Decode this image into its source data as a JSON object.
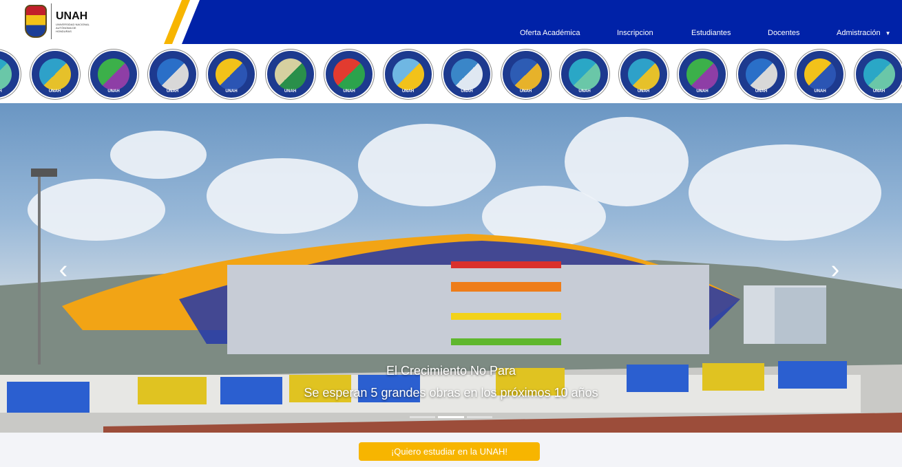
{
  "header": {
    "logo_name": "UNAH",
    "logo_sub": "UNIVERSIDAD NACIONAL AUTÓNOMA DE HONDURAS",
    "nav": [
      {
        "label": "Oferta Académica"
      },
      {
        "label": "Inscripcion"
      },
      {
        "label": "Estudiantes"
      },
      {
        "label": "Docentes"
      },
      {
        "label": "Admistración"
      }
    ],
    "colors": {
      "primary": "#0022a8",
      "accent": "#f7b500"
    }
  },
  "faculties": [
    {
      "label": "UNAH"
    },
    {
      "label": "UNAH"
    },
    {
      "label": "UNAH"
    },
    {
      "label": "UNAH"
    },
    {
      "label": "UNAH"
    },
    {
      "label": "UNAH"
    },
    {
      "label": "UNAH"
    },
    {
      "label": "UNAH"
    },
    {
      "label": "UNAH"
    },
    {
      "label": "UNAH"
    },
    {
      "label": "UNAH"
    },
    {
      "label": "UNAH"
    },
    {
      "label": "UNAH"
    },
    {
      "label": "UNAH"
    },
    {
      "label": "UNAH"
    },
    {
      "label": "UNAH"
    }
  ],
  "hero": {
    "title": "El Crecimiento No Para",
    "subtitle": "Se esperan 5 grandes obras en los próximos 10 años",
    "prev_icon": "chevron-left-icon",
    "next_icon": "chevron-right-icon",
    "slides_total": 3,
    "active_slide": 1
  },
  "cta": {
    "label": "¡Quiero estudiar en la UNAH!"
  }
}
